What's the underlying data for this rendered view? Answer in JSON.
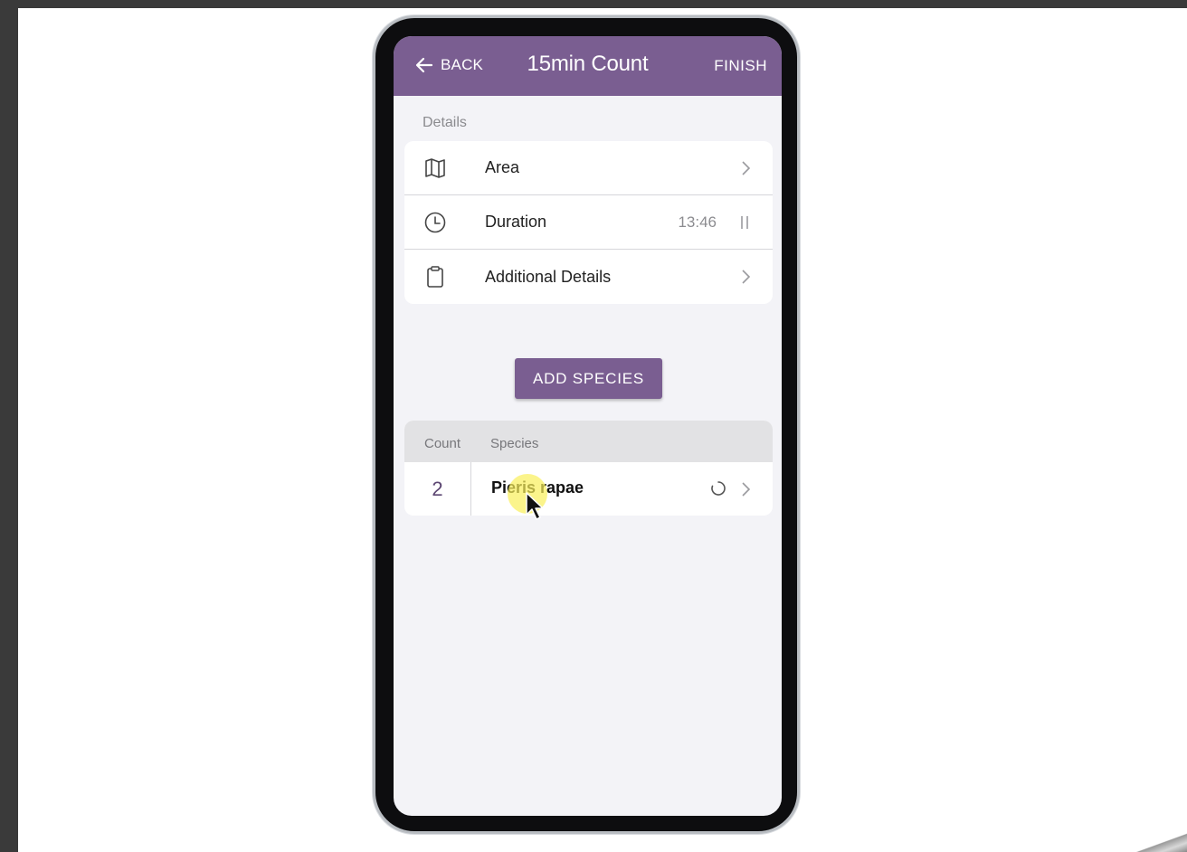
{
  "appbar": {
    "back_label": "BACK",
    "title": "15min Count",
    "finish_label": "FINISH",
    "color": "#7a5e91"
  },
  "details": {
    "section_label": "Details",
    "rows": [
      {
        "label": "Area",
        "icon": "map-icon",
        "value": ""
      },
      {
        "label": "Duration",
        "icon": "clock-icon",
        "value": "13:46"
      },
      {
        "label": "Additional Details",
        "icon": "clipboard-icon",
        "value": ""
      }
    ]
  },
  "add_species_label": "ADD SPECIES",
  "species_list": {
    "headers": {
      "count": "Count",
      "species": "Species"
    },
    "rows": [
      {
        "count": "2",
        "species": "Pieris rapae"
      }
    ]
  }
}
